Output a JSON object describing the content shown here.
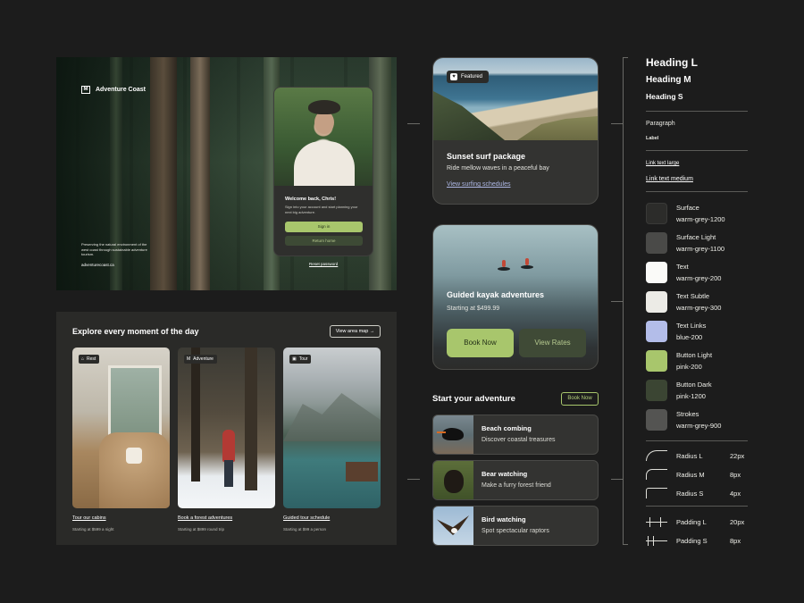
{
  "hero": {
    "brand": "Adventure Coast",
    "description": "Preserving the natural environment of the west coast through sustainable adventure tourism.",
    "site": "adventurecoast.ca",
    "login": {
      "title": "Welcome back, Chris!",
      "text": "Sign into your account and start planning your next big adventure.",
      "sign_in": "Sign in",
      "return_home": "Return home",
      "reset": "Reset password"
    }
  },
  "explore": {
    "title": "Explore every moment of the day",
    "map_button": "View area map",
    "cards": [
      {
        "tag": "Rest",
        "link": "Tour our cabins",
        "price": "Starting at $599 a night"
      },
      {
        "tag": "Adventure",
        "link": "Book a forest adventures",
        "price": "Starting at $899 round trip"
      },
      {
        "tag": "Tour",
        "link": "Guided tour schedule",
        "price": "Starting at $99 a person"
      }
    ]
  },
  "featured": {
    "tag": "Featured",
    "title": "Sunset surf package",
    "subtitle": "Ride mellow waves in a peaceful bay",
    "link": "View surfing schedules"
  },
  "kayak": {
    "title": "Guided kayak adventures",
    "price": "Starting at $499.99",
    "book": "Book Now",
    "rates": "View Rates"
  },
  "start": {
    "title": "Start your adventure",
    "book": "Book Now",
    "items": [
      {
        "title": "Beach combing",
        "subtitle": "Discover coastal treasures"
      },
      {
        "title": "Bear watching",
        "subtitle": "Make a furry forest friend"
      },
      {
        "title": "Bird watching",
        "subtitle": "Spot spectacular raptors"
      }
    ]
  },
  "guide": {
    "heading_l": "Heading L",
    "heading_m": "Heading M",
    "heading_s": "Heading S",
    "paragraph": "Paragraph",
    "label": "Label",
    "link_large": "Link text large",
    "link_medium": "Link text medium",
    "colors": [
      {
        "name": "Surface",
        "token": "warm-grey-1200",
        "hex": "#2c2c2a"
      },
      {
        "name": "Surface Light",
        "token": "warm-grey-1100",
        "hex": "#4a4a48"
      },
      {
        "name": "Text",
        "token": "warm-grey-200",
        "hex": "#fafaf8"
      },
      {
        "name": "Text Subtle",
        "token": "warm-grey-300",
        "hex": "#ecebe6"
      },
      {
        "name": "Text Links",
        "token": "blue-200",
        "hex": "#b3bde9"
      },
      {
        "name": "Button Light",
        "token": "pink-200",
        "hex": "#a8c66c"
      },
      {
        "name": "Button Dark",
        "token": "pink-1200",
        "hex": "#3b4533"
      },
      {
        "name": "Strokes",
        "token": "warm-grey-900",
        "hex": "#545452"
      }
    ],
    "radius": [
      {
        "name": "Radius L",
        "value": "22px"
      },
      {
        "name": "Radius M",
        "value": "8px"
      },
      {
        "name": "Radius S",
        "value": "4px"
      }
    ],
    "padding": [
      {
        "name": "Padding L",
        "value": "20px"
      },
      {
        "name": "Padding S",
        "value": "8px"
      }
    ]
  }
}
